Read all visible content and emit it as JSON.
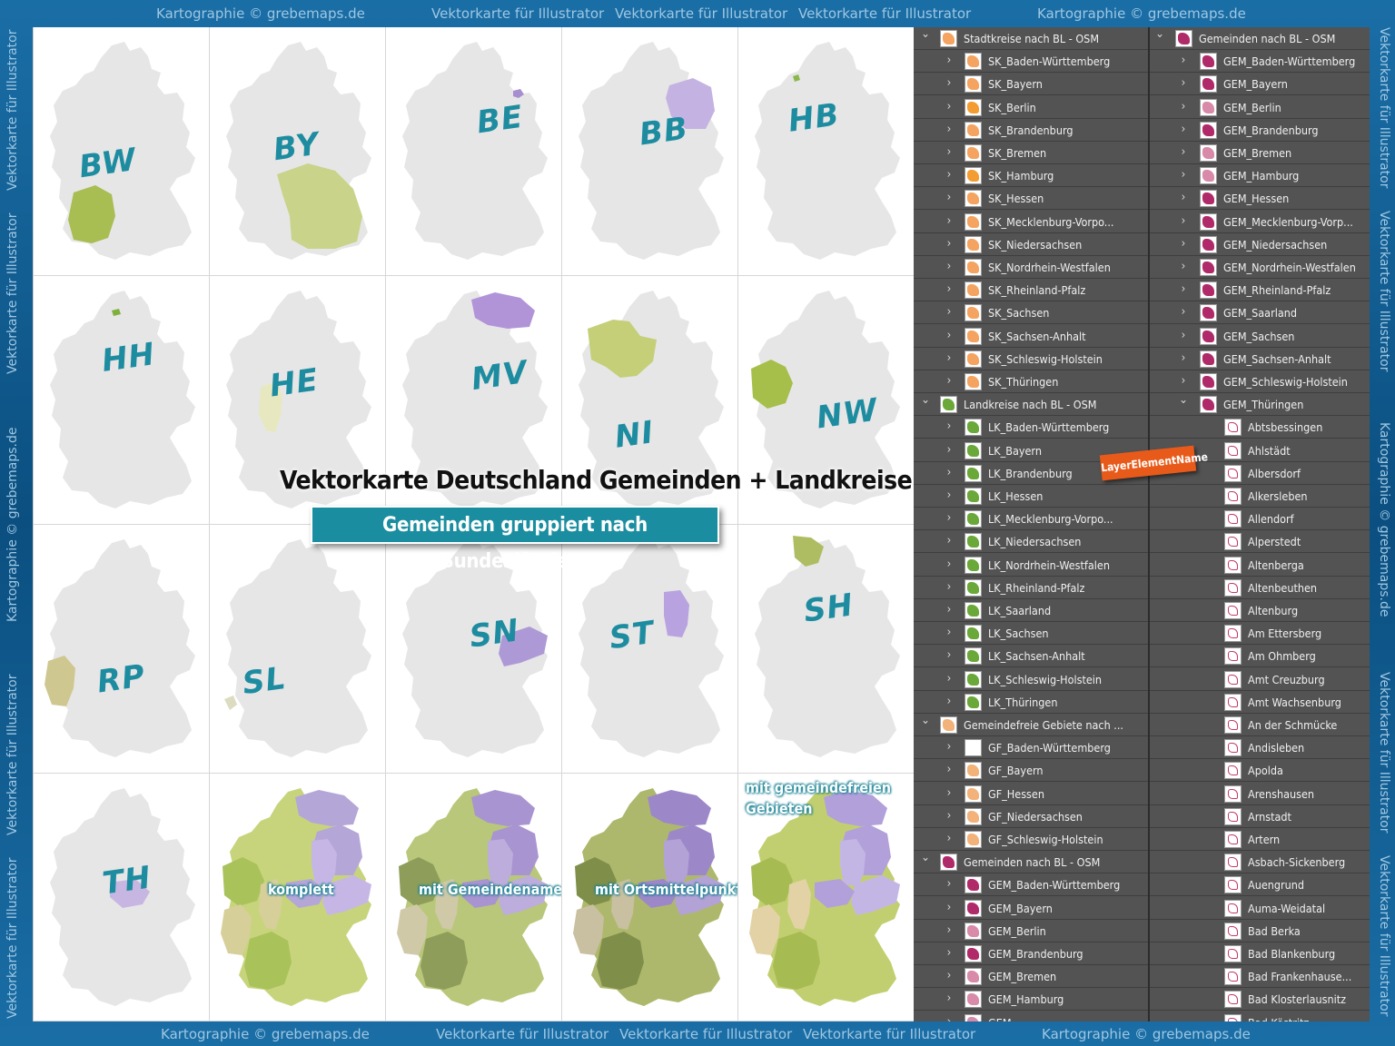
{
  "watermarks": {
    "credit": "Kartographie © grebemaps.de",
    "vector": "Vektorkarte für Illustrator"
  },
  "colors": {
    "frame": "#0e5a8c",
    "panel_bg": "#535353",
    "code_color": "#1e8ca0",
    "banner": "#1a8ea0",
    "tag": "#e85a1a",
    "green": "#b6c76a",
    "purple": "#b9a2d4",
    "grey_map": "#e6e6e6"
  },
  "maps": {
    "headline": "Vektorkarte Deutschland Gemeinden + Landkreise",
    "subtitle": "Gemeinden gruppiert nach Bundesländern",
    "tiles": [
      {
        "code": "BW"
      },
      {
        "code": "BY"
      },
      {
        "code": "BE"
      },
      {
        "code": "BB"
      },
      {
        "code": "HB"
      },
      {
        "code": "HH"
      },
      {
        "code": "HE"
      },
      {
        "code": "MV"
      },
      {
        "code": "NI"
      },
      {
        "code": "NW"
      },
      {
        "code": "RP"
      },
      {
        "code": "SL"
      },
      {
        "code": "SN"
      },
      {
        "code": "ST"
      },
      {
        "code": "SH"
      },
      {
        "code": "TH"
      }
    ],
    "full_labels": [
      "komplett",
      "mit Gemeindenamen",
      "mit Ortsmittelpunkten"
    ],
    "free_label_1": "mit gemeindefreien",
    "free_label_2": "Gebieten"
  },
  "layers_left": [
    {
      "label": "Stadtkreise nach BL - OSM",
      "level": 0,
      "expanded": true,
      "thumb": "sk"
    },
    {
      "label": "SK_Baden-Württemberg",
      "level": 1,
      "thumb": "sk"
    },
    {
      "label": "SK_Bayern",
      "level": 1,
      "thumb": "sk"
    },
    {
      "label": "SK_Berlin",
      "level": 1,
      "thumb": "sko"
    },
    {
      "label": "SK_Brandenburg",
      "level": 1,
      "thumb": "sk"
    },
    {
      "label": "SK_Bremen",
      "level": 1,
      "thumb": "sk"
    },
    {
      "label": "SK_Hamburg",
      "level": 1,
      "thumb": "sko"
    },
    {
      "label": "SK_Hessen",
      "level": 1,
      "thumb": "sk"
    },
    {
      "label": "SK_Mecklenburg-Vorpo...",
      "level": 1,
      "thumb": "sk"
    },
    {
      "label": "SK_Niedersachsen",
      "level": 1,
      "thumb": "sk"
    },
    {
      "label": "SK_Nordrhein-Westfalen",
      "level": 1,
      "thumb": "sk"
    },
    {
      "label": "SK_Rheinland-Pfalz",
      "level": 1,
      "thumb": "sk"
    },
    {
      "label": "SK_Sachsen",
      "level": 1,
      "thumb": "sk"
    },
    {
      "label": "SK_Sachsen-Anhalt",
      "level": 1,
      "thumb": "sk"
    },
    {
      "label": "SK_Schleswig-Holstein",
      "level": 1,
      "thumb": "sk"
    },
    {
      "label": "SK_Thüringen",
      "level": 1,
      "thumb": "sk"
    },
    {
      "label": "Landkreise nach BL - OSM",
      "level": 0,
      "expanded": true,
      "thumb": "lk"
    },
    {
      "label": "LK_Baden-Württemberg",
      "level": 1,
      "thumb": "lk"
    },
    {
      "label": "LK_Bayern",
      "level": 1,
      "thumb": "lk"
    },
    {
      "label": "LK_Brandenburg",
      "level": 1,
      "thumb": "lk"
    },
    {
      "label": "LK_Hessen",
      "level": 1,
      "thumb": "lk"
    },
    {
      "label": "LK_Mecklenburg-Vorpo...",
      "level": 1,
      "thumb": "lk"
    },
    {
      "label": "LK_Niedersachsen",
      "level": 1,
      "thumb": "lk"
    },
    {
      "label": "LK_Nordrhein-Westfalen",
      "level": 1,
      "thumb": "lk"
    },
    {
      "label": "LK_Rheinland-Pfalz",
      "level": 1,
      "thumb": "lk"
    },
    {
      "label": "LK_Saarland",
      "level": 1,
      "thumb": "lk"
    },
    {
      "label": "LK_Sachsen",
      "level": 1,
      "thumb": "lk"
    },
    {
      "label": "LK_Sachsen-Anhalt",
      "level": 1,
      "thumb": "lk"
    },
    {
      "label": "LK_Schleswig-Holstein",
      "level": 1,
      "thumb": "lk"
    },
    {
      "label": "LK_Thüringen",
      "level": 1,
      "thumb": "lk"
    },
    {
      "label": "Gemeindefreie Gebiete nach ...",
      "level": 0,
      "expanded": true,
      "thumb": "gf"
    },
    {
      "label": "GF_Baden-Württemberg",
      "level": 1,
      "thumb": "blank"
    },
    {
      "label": "GF_Bayern",
      "level": 1,
      "thumb": "gf"
    },
    {
      "label": "GF_Hessen",
      "level": 1,
      "thumb": "gf"
    },
    {
      "label": "GF_Niedersachsen",
      "level": 1,
      "thumb": "gf"
    },
    {
      "label": "GF_Schleswig-Holstein",
      "level": 1,
      "thumb": "gf"
    },
    {
      "label": "Gemeinden nach BL - OSM",
      "level": 0,
      "expanded": true,
      "thumb": "gem"
    },
    {
      "label": "GEM_Baden-Württemberg",
      "level": 1,
      "thumb": "gem"
    },
    {
      "label": "GEM_Bayern",
      "level": 1,
      "thumb": "gem"
    },
    {
      "label": "GEM_Berlin",
      "level": 1,
      "thumb": "geml"
    },
    {
      "label": "GEM_Brandenburg",
      "level": 1,
      "thumb": "gem"
    },
    {
      "label": "GEM_Bremen",
      "level": 1,
      "thumb": "geml"
    },
    {
      "label": "GEM_Hamburg",
      "level": 1,
      "thumb": "geml"
    },
    {
      "label": "GEM_...",
      "level": 1,
      "thumb": "geml"
    }
  ],
  "layers_right": [
    {
      "label": "Gemeinden nach BL - OSM",
      "level": 0,
      "expanded": true,
      "thumb": "gem"
    },
    {
      "label": "GEM_Baden-Württemberg",
      "level": 1,
      "thumb": "gem"
    },
    {
      "label": "GEM_Bayern",
      "level": 1,
      "thumb": "gem"
    },
    {
      "label": "GEM_Berlin",
      "level": 1,
      "thumb": "geml"
    },
    {
      "label": "GEM_Brandenburg",
      "level": 1,
      "thumb": "gem"
    },
    {
      "label": "GEM_Bremen",
      "level": 1,
      "thumb": "geml"
    },
    {
      "label": "GEM_Hamburg",
      "level": 1,
      "thumb": "geml"
    },
    {
      "label": "GEM_Hessen",
      "level": 1,
      "thumb": "gem"
    },
    {
      "label": "GEM_Mecklenburg-Vorp...",
      "level": 1,
      "thumb": "gem"
    },
    {
      "label": "GEM_Niedersachsen",
      "level": 1,
      "thumb": "gem"
    },
    {
      "label": "GEM_Nordrhein-Westfalen",
      "level": 1,
      "thumb": "gem"
    },
    {
      "label": "GEM_Rheinland-Pfalz",
      "level": 1,
      "thumb": "gem"
    },
    {
      "label": "GEM_Saarland",
      "level": 1,
      "thumb": "gem"
    },
    {
      "label": "GEM_Sachsen",
      "level": 1,
      "thumb": "gem"
    },
    {
      "label": "GEM_Sachsen-Anhalt",
      "level": 1,
      "thumb": "gem"
    },
    {
      "label": "GEM_Schleswig-Holstein",
      "level": 1,
      "thumb": "gem"
    },
    {
      "label": "GEM_Thüringen",
      "level": 1,
      "expanded": true,
      "thumb": "gem"
    },
    {
      "label": "Abtsbessingen",
      "level": 2,
      "thumb": "out"
    },
    {
      "label": "Ahlstädt",
      "level": 2,
      "thumb": "out"
    },
    {
      "label": "Albersdorf",
      "level": 2,
      "thumb": "out"
    },
    {
      "label": "Alkersleben",
      "level": 2,
      "thumb": "out"
    },
    {
      "label": "Allendorf",
      "level": 2,
      "thumb": "out"
    },
    {
      "label": "Alperstedt",
      "level": 2,
      "thumb": "out"
    },
    {
      "label": "Altenberga",
      "level": 2,
      "thumb": "out"
    },
    {
      "label": "Altenbeuthen",
      "level": 2,
      "thumb": "out"
    },
    {
      "label": "Altenburg",
      "level": 2,
      "thumb": "out"
    },
    {
      "label": "Am Ettersberg",
      "level": 2,
      "thumb": "out"
    },
    {
      "label": "Am Ohmberg",
      "level": 2,
      "thumb": "out"
    },
    {
      "label": "Amt Creuzburg",
      "level": 2,
      "thumb": "out"
    },
    {
      "label": "Amt Wachsenburg",
      "level": 2,
      "thumb": "out"
    },
    {
      "label": "An der Schmücke",
      "level": 2,
      "thumb": "out"
    },
    {
      "label": "Andisleben",
      "level": 2,
      "thumb": "out"
    },
    {
      "label": "Apolda",
      "level": 2,
      "thumb": "out"
    },
    {
      "label": "Arenshausen",
      "level": 2,
      "thumb": "out"
    },
    {
      "label": "Arnstadt",
      "level": 2,
      "thumb": "out"
    },
    {
      "label": "Artern",
      "level": 2,
      "thumb": "out"
    },
    {
      "label": "Asbach-Sickenberg",
      "level": 2,
      "thumb": "out"
    },
    {
      "label": "Auengrund",
      "level": 2,
      "thumb": "out"
    },
    {
      "label": "Auma-Weidatal",
      "level": 2,
      "thumb": "out"
    },
    {
      "label": "Bad Berka",
      "level": 2,
      "thumb": "out"
    },
    {
      "label": "Bad Blankenburg",
      "level": 2,
      "thumb": "out"
    },
    {
      "label": "Bad Frankenhause...",
      "level": 2,
      "thumb": "out"
    },
    {
      "label": "Bad Klosterlausnitz",
      "level": 2,
      "thumb": "out"
    },
    {
      "label": "Bad Köstritz",
      "level": 2,
      "thumb": "out"
    }
  ],
  "tag_label": "LayerElementName"
}
